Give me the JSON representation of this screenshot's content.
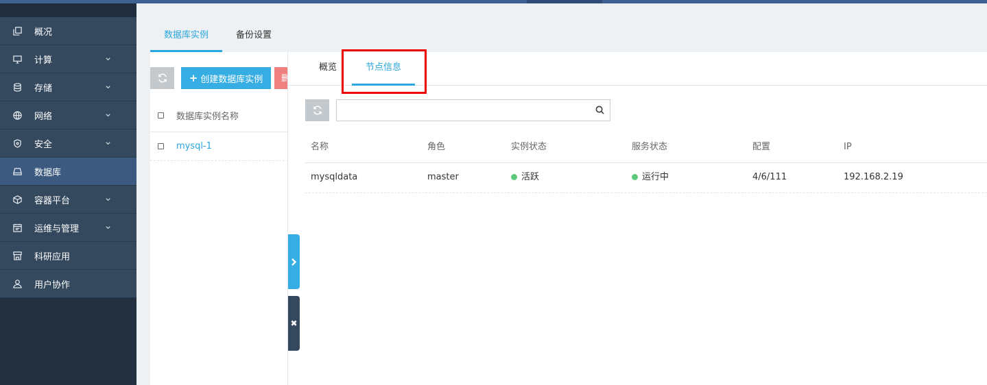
{
  "colors": {
    "accent": "#2ba6de",
    "sidebar": "#34495e",
    "sidebar_active": "#3c5a80",
    "status_green": "#5cc97a",
    "highlight": "#e00000"
  },
  "sidebar": {
    "items": [
      {
        "label": "概况",
        "icon": "copy-icon",
        "expandable": false
      },
      {
        "label": "计算",
        "icon": "monitor-icon",
        "expandable": true
      },
      {
        "label": "存储",
        "icon": "database-icon",
        "expandable": true
      },
      {
        "label": "网络",
        "icon": "globe-icon",
        "expandable": true
      },
      {
        "label": "安全",
        "icon": "shield-icon",
        "expandable": true
      },
      {
        "label": "数据库",
        "icon": "drive-icon",
        "expandable": false,
        "active": true
      },
      {
        "label": "容器平台",
        "icon": "cube-icon",
        "expandable": true
      },
      {
        "label": "运维与管理",
        "icon": "calendar-icon",
        "expandable": true
      },
      {
        "label": "科研应用",
        "icon": "store-icon",
        "expandable": false
      },
      {
        "label": "用户协作",
        "icon": "users-icon",
        "expandable": false
      }
    ]
  },
  "main_tabs": [
    {
      "label": "数据库实例",
      "active": true
    },
    {
      "label": "备份设置",
      "active": false
    }
  ],
  "list_panel": {
    "refresh_icon": "refresh-icon",
    "create_label": "创建数据库实例",
    "delete_label": "删",
    "header": "数据库实例名称",
    "rows": [
      {
        "name": "mysql-1"
      }
    ]
  },
  "detail": {
    "tabs": [
      {
        "label": "概览",
        "active": false
      },
      {
        "label": "节点信息",
        "active": true
      }
    ],
    "search": {
      "value": "",
      "placeholder": ""
    },
    "table": {
      "columns": [
        "名称",
        "角色",
        "实例状态",
        "服务状态",
        "配置",
        "IP"
      ],
      "rows": [
        {
          "name": "mysqldata",
          "role": "master",
          "instance_status": "活跃",
          "service_status": "运行中",
          "config": "4/6/111",
          "ip": "192.168.2.19"
        }
      ]
    }
  },
  "handles": {
    "close_glyph": "✖"
  }
}
